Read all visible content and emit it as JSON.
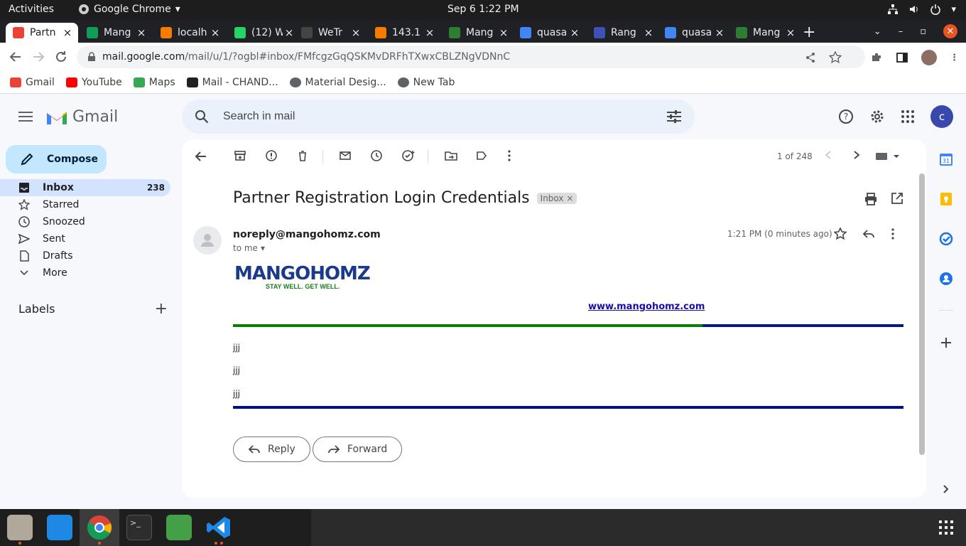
{
  "os": {
    "activities": "Activities",
    "app_name": "Google Chrome",
    "clock": "Sep 6  1:22 PM"
  },
  "tabs": [
    {
      "title": "Partn",
      "favicon": "gmail-icon",
      "color": "#ea4335",
      "active": true
    },
    {
      "title": "Mang",
      "favicon": "sheets-icon",
      "color": "#0f9d58"
    },
    {
      "title": "localh",
      "favicon": "cone-icon",
      "color": "#f57c00"
    },
    {
      "title": "(12) W",
      "favicon": "whatsapp-icon",
      "color": "#25d366"
    },
    {
      "title": "WeTr",
      "favicon": "wetransfer-icon",
      "color": "#444444"
    },
    {
      "title": "143.1",
      "favicon": "cone-icon",
      "color": "#f57c00"
    },
    {
      "title": "Mang",
      "favicon": "clover-icon",
      "color": "#2e7d32"
    },
    {
      "title": "quasa",
      "favicon": "google-icon",
      "color": "#4285f4"
    },
    {
      "title": "Rang",
      "favicon": "compass-icon",
      "color": "#3f51b5"
    },
    {
      "title": "quasa",
      "favicon": "google-icon",
      "color": "#4285f4"
    },
    {
      "title": "Mang",
      "favicon": "clover-icon",
      "color": "#2e7d32"
    }
  ],
  "address": {
    "host": "mail.google.com",
    "path": "/mail/u/1/?ogbl#inbox/FMfcgzGqQSKMvDRFhTXwxCBLZNgVDNnC"
  },
  "bookmarks": [
    {
      "label": "Gmail",
      "icon": "gmail-icon"
    },
    {
      "label": "YouTube",
      "icon": "youtube-icon"
    },
    {
      "label": "Maps",
      "icon": "maps-pin-icon"
    },
    {
      "label": "Mail - CHAND...",
      "icon": "outlook-icon"
    },
    {
      "label": "Material Desig...",
      "icon": "globe-icon"
    },
    {
      "label": "New Tab",
      "icon": "globe-icon"
    }
  ],
  "gmail": {
    "brand": "Gmail",
    "search_placeholder": "Search in mail",
    "account_initial": "c",
    "compose": "Compose",
    "nav": [
      {
        "label": "Inbox",
        "count": "238",
        "icon": "inbox-icon",
        "active": true
      },
      {
        "label": "Starred",
        "count": "",
        "icon": "star-icon"
      },
      {
        "label": "Snoozed",
        "count": "",
        "icon": "clock-icon"
      },
      {
        "label": "Sent",
        "count": "",
        "icon": "send-icon"
      },
      {
        "label": "Drafts",
        "count": "",
        "icon": "draft-icon"
      },
      {
        "label": "More",
        "count": "",
        "icon": "chevron-down-icon"
      }
    ],
    "labels_heading": "Labels",
    "pager": "1 of 248"
  },
  "message": {
    "subject": "Partner Registration Login Credentials",
    "label_chip": "Inbox",
    "sender": "noreply@mangohomz.com",
    "to": "to me",
    "time": "1:21 PM (0 minutes ago)",
    "logo_main": "MANGOHOMZ",
    "logo_tagline": "STAY WELL. GET WELL.",
    "website": "www.mangohomz.com",
    "body_lines": [
      "jjj",
      "jjj",
      "jjj"
    ],
    "reply": "Reply",
    "forward": "Forward"
  }
}
